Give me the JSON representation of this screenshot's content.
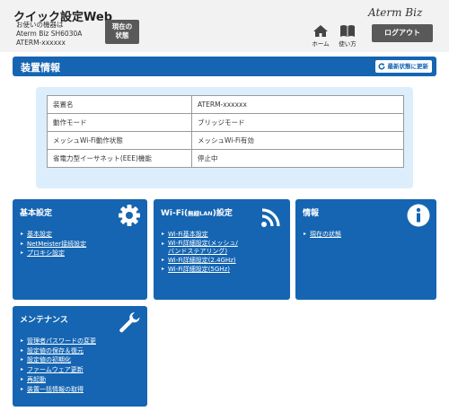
{
  "header": {
    "app_title": "クイック設定Web",
    "device_lines": [
      "お使いの機器は",
      "Aterm Biz SH6030A",
      "ATERM-xxxxxx"
    ],
    "status_button": [
      "現在の",
      "状態"
    ],
    "logo": "Aterm Biz",
    "home_label": "ホーム",
    "manual_label": "使い方",
    "logout_label": "ログアウト"
  },
  "section": {
    "title": "装置情報",
    "refresh_label": "最新状態に更新"
  },
  "device_table": [
    {
      "key": "装置名",
      "value": "ATERM-xxxxxx"
    },
    {
      "key": "動作モード",
      "value": "ブリッジモード"
    },
    {
      "key": "メッシュWi-Fi動作状態",
      "value": "メッシュWi-Fi有効"
    },
    {
      "key": "省電力型イーサネット(EEE)機能",
      "value": "停止中"
    }
  ],
  "cards": {
    "basic": {
      "title": "基本設定",
      "icon": "gear-icon",
      "links": [
        "基本設定",
        "NetMeister接続設定",
        "プロキシ設定"
      ]
    },
    "wifi": {
      "title_main": "Wi-Fi(",
      "title_small": "無線LAN",
      "title_end": ")設定",
      "icon": "wifi-icon",
      "links": [
        "Wi-Fi基本設定",
        "Wi-Fi詳細設定(メッシュ/",
        "バンドステアリング)",
        "Wi-Fi詳細設定(2.4GHz)",
        "Wi-Fi詳細設定(5GHz)"
      ]
    },
    "info": {
      "title": "情報",
      "icon": "info-icon",
      "links": [
        "現在の状態"
      ]
    },
    "maintenance": {
      "title": "メンテナンス",
      "icon": "wrench-icon",
      "links": [
        "管理者パスワードの変更",
        "設定値の保存＆復元",
        "設定値の初期化",
        "ファームウェア更新",
        "再起動",
        "装置一括情報の取得"
      ]
    }
  },
  "colors": {
    "primary": "#1565b2",
    "panel": "#dceefb",
    "header_bg": "#f2f2f2",
    "button_gray": "#595959"
  }
}
